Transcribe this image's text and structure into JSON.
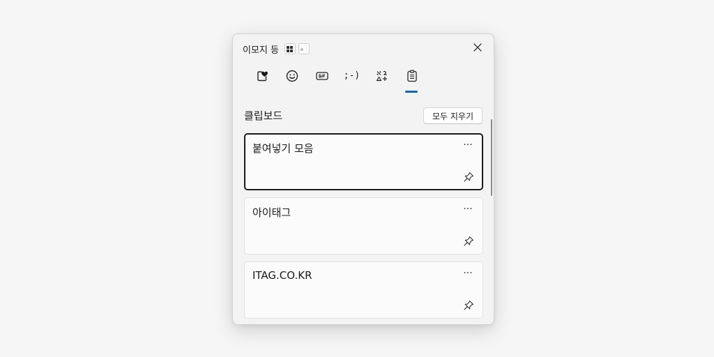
{
  "window": {
    "title": "이모지 등",
    "shortcut_key_text": "。",
    "close_icon": "close-icon",
    "shortcut_icon": "windows-logo-icon"
  },
  "tabs": [
    {
      "name": "favorites",
      "icon": "heart-sticker-icon",
      "active": false
    },
    {
      "name": "emoji",
      "icon": "smiley-icon",
      "active": false
    },
    {
      "name": "gif",
      "icon": "gif-icon",
      "active": false
    },
    {
      "name": "kaomoji",
      "label": ";-)",
      "active": false
    },
    {
      "name": "symbols",
      "icon": "symbols-icon",
      "active": false
    },
    {
      "name": "clipboard",
      "icon": "clipboard-icon",
      "active": true
    }
  ],
  "clipboard": {
    "title": "클립보드",
    "clear_all_label": "모두 지우기",
    "more_label": "···",
    "items": [
      {
        "text": "붙여넣기 모음",
        "selected": true
      },
      {
        "text": "아이태그",
        "selected": false
      },
      {
        "text": "ITAG.CO.KR",
        "selected": false
      }
    ]
  },
  "colors": {
    "accent": "#0067c0",
    "panel_bg": "#f3f3f3",
    "page_bg": "#f6f6f6"
  }
}
